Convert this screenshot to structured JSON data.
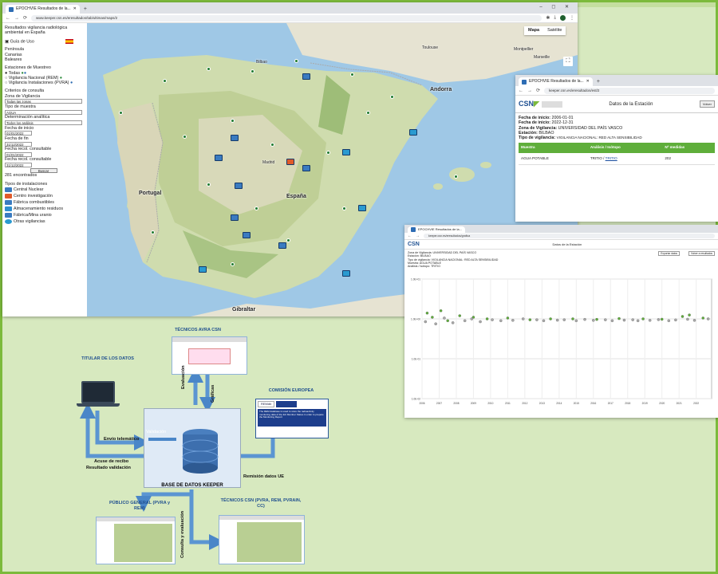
{
  "main_window": {
    "tab_title": "EPOCHVIE Resultados de la...",
    "url": "www.keeper.csn.es/eresultados/tab/ultimas/maps/2",
    "window_controls": "– ◻ ✕",
    "sidebar": {
      "title": "Resultados vigilancia radiológica ambiental en España",
      "guide": "Guía de Uso",
      "regions": [
        "Península",
        "Canarias",
        "Baleares"
      ],
      "stations_heading": "Estaciones de Muestreo",
      "station_options": [
        "Todas",
        "Vigilancia Nacional (REM)",
        "Vigilancia Instalaciones (PVRA)"
      ],
      "criteria_heading": "Criterios de consulta",
      "zone_label": "Zona de Vigilancia",
      "zone_value": "Todas las zonas",
      "sample_label": "Tipo de muestra",
      "sample_value": "AGUA",
      "determination_label": "Determinación analítica",
      "determination_value": "Todos los análisis",
      "start_label": "Fecha de inicio",
      "start_value": "01/01/2022",
      "end_label": "Fecha de fin",
      "end_value": "31/12/2022",
      "consult_date_label": "Fecha recol. consultable",
      "consult_date_value": "01/01/2022",
      "consult_date2_label": "Fecha recol. consultable",
      "consult_date2_value": "31/12/2022",
      "search_button": "Buscar",
      "found": "281 encontrados",
      "types_heading": "Tipos de instalaciones",
      "types": [
        {
          "label": "Central Nuclear",
          "color": "#3a7bc0"
        },
        {
          "label": "Centro investigación",
          "color": "#e05a2a"
        },
        {
          "label": "Fábrica combustibles",
          "color": "#3a7bc0"
        },
        {
          "label": "Almacenamiento residuos",
          "color": "#2f8fcf"
        },
        {
          "label": "Fábrica/Mina uranio",
          "color": "#3a7bc0"
        },
        {
          "label": "Otras vigilancias",
          "color": "#2a9ad0"
        }
      ]
    },
    "map": {
      "tab_map": "Mapa",
      "tab_satellite": "Satélite",
      "labels": {
        "portugal": "Portugal",
        "spain": "España",
        "andorra": "Andorra",
        "gibraltar": "Gibraltar",
        "toulouse": "Toulouse",
        "montpellier": "Montpellier",
        "marseille": "Marseille",
        "bilbao": "Bilbao",
        "madrid": "Madrid"
      }
    }
  },
  "station_window": {
    "tab_title": "EPOCHVIE Resultados de la...",
    "url": "keeper.csn.es/eresultados/est/2",
    "logo": "CSN",
    "title": "Datos de la Estación",
    "button": "Volver",
    "start_label": "Fecha de inicio:",
    "start_value": "2006-01-01",
    "end_label": "Fecha de inicio:",
    "end_value": "2022-12-31",
    "zone_label": "Zona de Vigilancia:",
    "zone_value": "UNIVERSIDAD DEL PAÍS VASCO",
    "station_label": "Estación:",
    "station_value": "BILBAO",
    "type_label": "Tipo de vigilancia:",
    "type_value": "VIGILANCIA NACIONAL: RED ALTA SENSIBILIDAD",
    "table_headers": [
      "Muestra",
      "Análisis / Isótopo",
      "Nº medidas"
    ],
    "table_rows": [
      {
        "muestra": "AGUA POTABLE",
        "analisis": "TRITIO",
        "link": "TRITIO",
        "medidas": "202"
      }
    ]
  },
  "chart_window": {
    "tab_title": "EPOCHVIE Resultados de la...",
    "url": "keeper.csn.es/eresultados/grafica",
    "title": "Datos de la Estación",
    "info_lines": [
      "Zona de Vigilancia: UNIVERSIDAD DEL PAÍS VASCO",
      "Estación: BILBAO",
      "Tipo de vigilancia: VIGILANCIA NACIONAL: RED ALTA SENSIBILIDAD",
      "Muestra: AGUA POTABLE",
      "Análisis / Isótopo: TRITIO"
    ],
    "buttons": [
      "Exportar datos",
      "Volver a resultados"
    ]
  },
  "chart_data": {
    "type": "scatter",
    "title": "",
    "xlabel": "",
    "ylabel": "",
    "x_ticks": [
      "2006",
      "2007",
      "2008",
      "2009",
      "2010",
      "2011",
      "2012",
      "2013",
      "2014",
      "2015",
      "2016",
      "2017",
      "2018",
      "2019",
      "2020",
      "2021",
      "2022"
    ],
    "y_ticks": [
      "1.0E+01",
      "1.0E+00",
      "1.0E-01",
      "1.0E-02"
    ],
    "log_scale": true,
    "grid": true,
    "series": [
      {
        "color": "#5fae3b",
        "x": [
          2006.3,
          2006.6,
          2007.1,
          2007.5,
          2008.2,
          2009.0,
          2009.8,
          2011.0,
          2012.3,
          2013.5,
          2014.8,
          2016.2,
          2017.5,
          2018.9,
          2020.0,
          2021.2,
          2021.6,
          2022.4
        ],
        "y": [
          1.4,
          1.1,
          1.6,
          0.9,
          1.2,
          1.1,
          1.0,
          1.05,
          0.95,
          1.0,
          1.0,
          0.97,
          1.02,
          1.0,
          0.98,
          1.15,
          1.25,
          1.05
        ]
      },
      {
        "color": "#aaaaaa",
        "x": [
          2006.2,
          2006.8,
          2007.3,
          2007.8,
          2008.5,
          2008.9,
          2009.4,
          2010.1,
          2010.6,
          2011.3,
          2011.9,
          2012.7,
          2013.1,
          2013.9,
          2014.3,
          2015.0,
          2015.5,
          2016.0,
          2016.7,
          2017.1,
          2017.8,
          2018.3,
          2018.6,
          2019.3,
          2019.8,
          2020.4,
          2020.8,
          2021.5,
          2021.9,
          2022.7
        ],
        "y": [
          0.85,
          0.75,
          1.05,
          0.8,
          0.9,
          1.0,
          0.85,
          0.95,
          0.9,
          0.92,
          1.0,
          0.95,
          0.9,
          0.93,
          0.95,
          0.9,
          0.97,
          0.92,
          0.95,
          0.9,
          0.93,
          0.95,
          0.9,
          0.92,
          0.96,
          0.9,
          0.94,
          0.98,
          0.92,
          1.0
        ]
      }
    ]
  },
  "diagram": {
    "titular": "TITULAR DE LOS DATOS",
    "tecnicos_avra": "TÉCNICOS AVRA CSN",
    "comision": "COMISIÓN EUROPEA",
    "publico": "PÚBLICO GENERAL (PVRA y REM)",
    "tecnicos_csn": "TÉCNICOS CSN (PVRA, REM, PVRAIN, CC)",
    "envio": "Envío telemático",
    "acuse": "Acuse de recibo",
    "resultado": "Resultado validación",
    "validacion": "Validación",
    "evaluacion": "Evaluación",
    "graficas": "Gráficas",
    "remision": "Remisión datos UE",
    "consulta": "Consulta y evaluación",
    "base": "BASE DE DATOS KEEPER",
    "rem_logo": "REMdb",
    "ec_text": "The REM database is used to store the radioactivity monitoring data of the EU Member States in order to prepare the Monitoring Report"
  },
  "colors": {
    "accent_green": "#5fae3b",
    "csn_blue": "#1d4f91",
    "frame": "#7cba3c"
  }
}
